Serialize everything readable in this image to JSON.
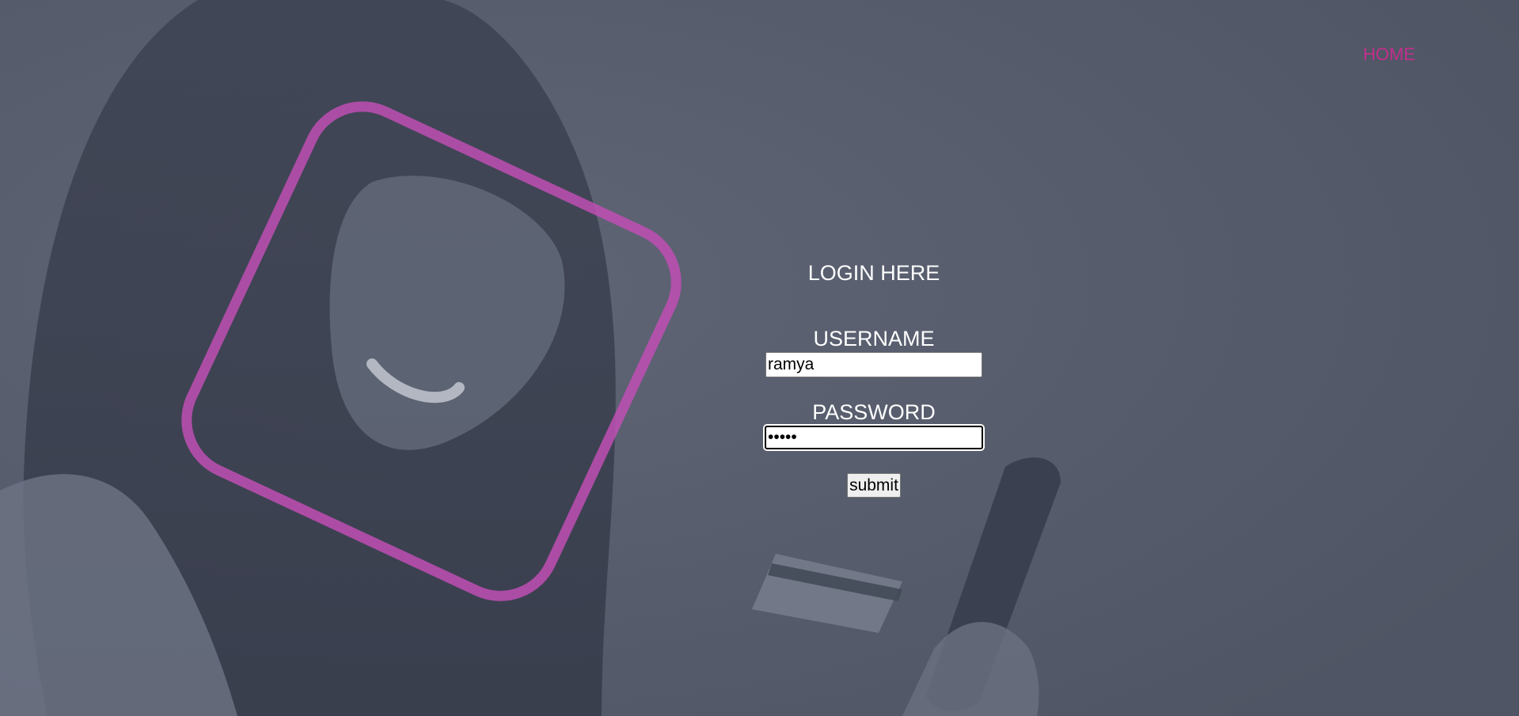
{
  "nav": {
    "home_label": "HOME"
  },
  "login": {
    "title": "LOGIN HERE",
    "username_label": "USERNAME",
    "username_value": "ramya",
    "password_label": "PASSWORD",
    "password_value": "•••••",
    "submit_label": "submit"
  },
  "colors": {
    "overlay": "#575d6c",
    "accent": "#c42e8c",
    "frame": "#c04fb4"
  }
}
